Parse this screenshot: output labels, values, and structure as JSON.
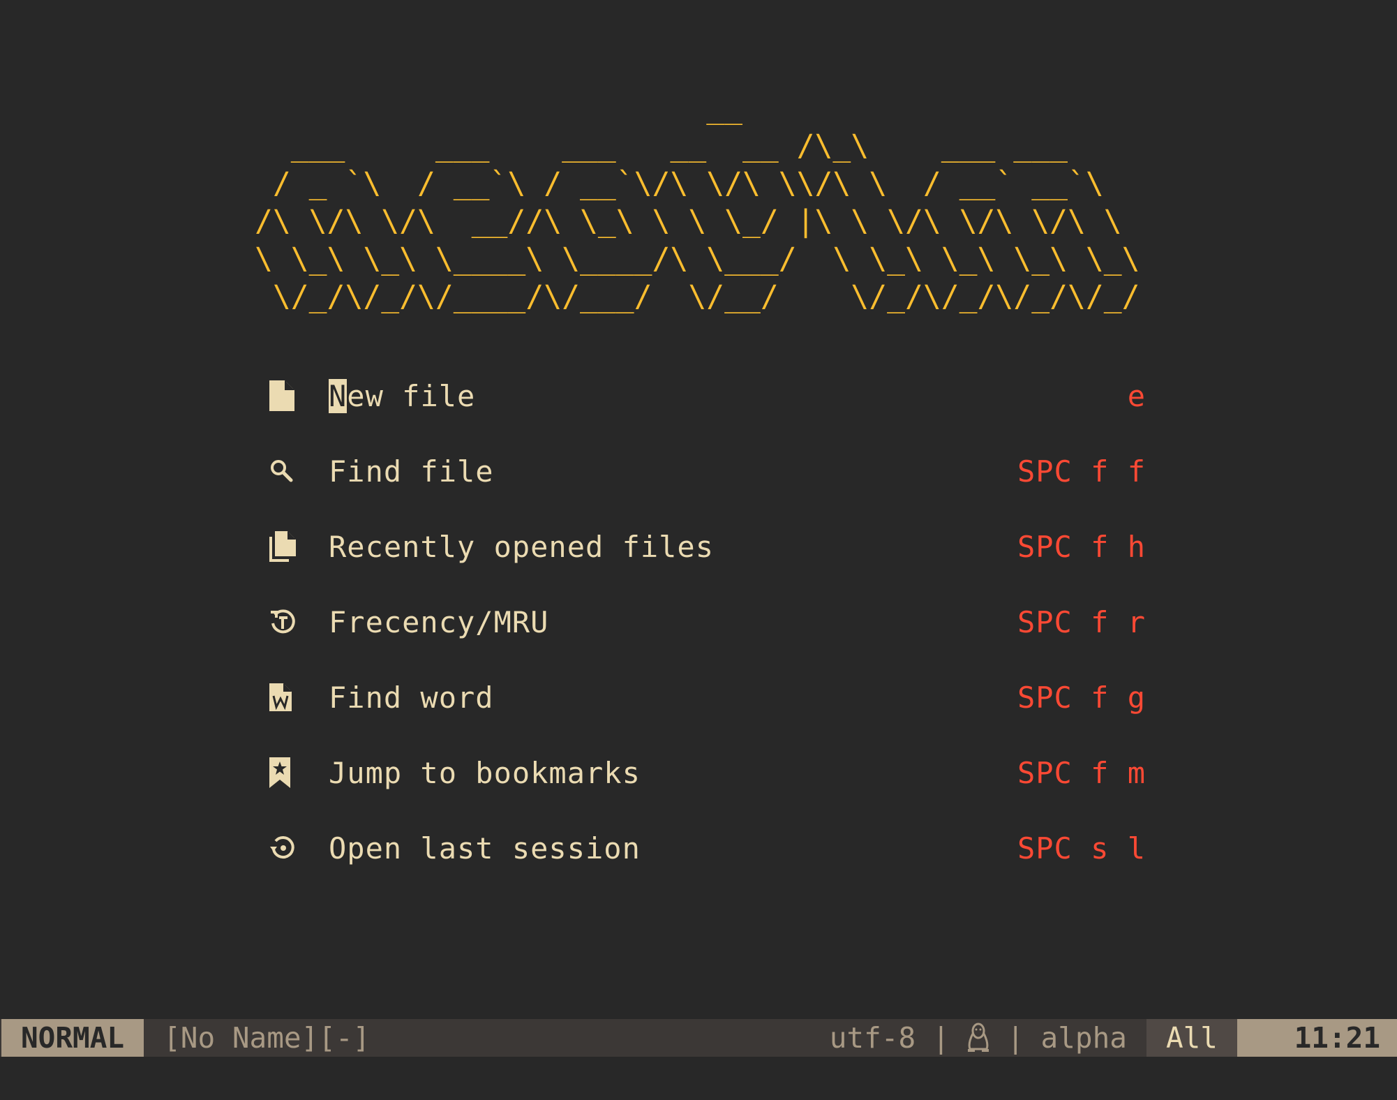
{
  "banner": {
    "ascii": "                         __\n  ___     ___    ___   __  __ /\\_\\    ___ ___\n / _ `\\  / __`\\ / __`\\/\\ \\/\\ \\\\/\\ \\  / __` __`\\\n/\\ \\/\\ \\/\\  __//\\ \\_\\ \\ \\ \\_/ |\\ \\ \\/\\ \\/\\ \\/\\ \\\n\\ \\_\\ \\_\\ \\____\\ \\____/\\ \\___/  \\ \\_\\ \\_\\ \\_\\ \\_\\\n \\/_/\\/_/\\/____/\\/___/  \\/__/    \\/_/\\/_/\\/_/\\/_/",
    "color": "#fabd2f"
  },
  "menu": {
    "items": [
      {
        "label_first": "N",
        "label_rest": "ew file",
        "shortcut": "e",
        "icon": "file-icon"
      },
      {
        "label": "Find file",
        "shortcut": "SPC f f",
        "icon": "search-icon"
      },
      {
        "label": "Recently opened files",
        "shortcut": "SPC f h",
        "icon": "files-icon"
      },
      {
        "label": "Frecency/MRU",
        "shortcut": "SPC f r",
        "icon": "history-icon"
      },
      {
        "label": "Find word",
        "shortcut": "SPC f g",
        "icon": "file-word-icon"
      },
      {
        "label": "Jump to bookmarks",
        "shortcut": "SPC f m",
        "icon": "bookmark-icon"
      },
      {
        "label": "Open last session",
        "shortcut": "SPC s l",
        "icon": "restore-icon"
      }
    ]
  },
  "statusline": {
    "mode": "NORMAL",
    "filename": "[No Name][-]",
    "encoding": "utf-8",
    "separator": "|",
    "os_icon": "linux-icon",
    "filetype": "alpha",
    "position": "All",
    "time": "11:21"
  },
  "colors": {
    "background": "#282828",
    "foreground": "#ebdbb2",
    "accent_yellow": "#fabd2f",
    "shortcut_red": "#fb4934",
    "statusline_bg": "#3c3836",
    "mode_bg": "#a89984"
  }
}
